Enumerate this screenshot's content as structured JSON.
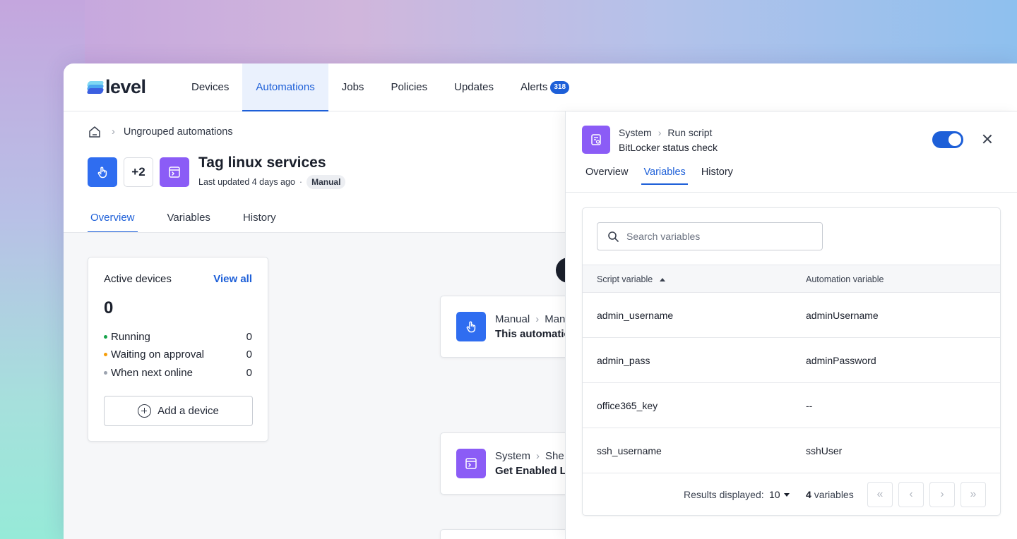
{
  "nav": {
    "logo_text": "level",
    "items": [
      {
        "label": "Devices"
      },
      {
        "label": "Automations"
      },
      {
        "label": "Jobs"
      },
      {
        "label": "Policies"
      },
      {
        "label": "Updates"
      },
      {
        "label": "Alerts"
      }
    ],
    "alerts_badge": "318",
    "active": "Automations"
  },
  "breadcrumb": {
    "home_icon": "home-icon",
    "current": "Ungrouped automations"
  },
  "automation": {
    "extra_count": "+2",
    "title": "Tag linux services",
    "updated": "Last updated 4 days ago",
    "separator": "·",
    "trigger_pill": "Manual"
  },
  "left_tabs": [
    {
      "label": "Overview"
    },
    {
      "label": "Variables"
    },
    {
      "label": "History"
    }
  ],
  "devices_card": {
    "title": "Active devices",
    "view_all": "View all",
    "count": "0",
    "stats": [
      {
        "label": "Running",
        "value": "0",
        "color": "#16a34a"
      },
      {
        "label": "Waiting on approval",
        "value": "0",
        "color": "#f59e0b"
      },
      {
        "label": "When next online",
        "value": "0",
        "color": "#9ca3af"
      }
    ],
    "add_button": "Add a device"
  },
  "flow": [
    {
      "crumb_a": "Manual",
      "crumb_b": "Man",
      "title": "This automatio"
    },
    {
      "crumb_a": "System",
      "crumb_b": "She",
      "title": "Get Enabled Li"
    }
  ],
  "panel": {
    "crumb_a": "System",
    "crumb_b": "Run script",
    "title": "BitLocker status check",
    "enabled": true,
    "tabs": [
      {
        "label": "Overview"
      },
      {
        "label": "Variables"
      },
      {
        "label": "History"
      }
    ],
    "search_placeholder": "Search variables",
    "columns": {
      "script": "Script variable",
      "automation": "Automation variable"
    },
    "rows": [
      {
        "script": "admin_username",
        "automation": "adminUsername"
      },
      {
        "script": "admin_pass",
        "automation": "adminPassword"
      },
      {
        "script": "office365_key",
        "automation": "--"
      },
      {
        "script": "ssh_username",
        "automation": "sshUser"
      }
    ],
    "footer": {
      "results_label": "Results displayed:",
      "page_size": "10",
      "count_number": "4",
      "count_suffix": "variables"
    }
  },
  "colors": {
    "accent": "#1d5fd8",
    "blue_tile": "#2f6df0",
    "purple_tile": "#8b5cf6"
  }
}
